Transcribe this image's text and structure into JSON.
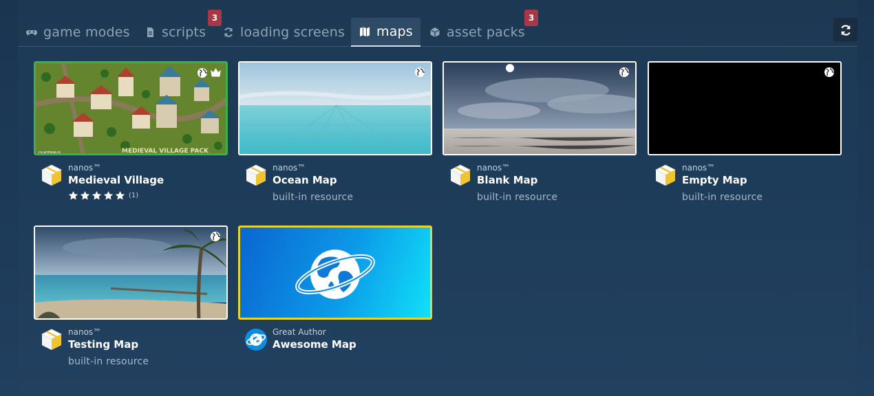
{
  "tabs": [
    {
      "label": "game modes",
      "icon": "gamepad-icon"
    },
    {
      "label": "scripts",
      "icon": "file-icon",
      "badge": "3"
    },
    {
      "label": "loading screens",
      "icon": "refresh-icon"
    },
    {
      "label": "maps",
      "icon": "map-icon",
      "active": true
    },
    {
      "label": "asset packs",
      "icon": "cube-icon",
      "badge": "3"
    }
  ],
  "toolbar": {
    "refresh_icon": "refresh-icon"
  },
  "maps": [
    {
      "author": "nanos™",
      "title": "Medieval Village",
      "rating_count": "(1)",
      "stars": 5,
      "thumb_text": "MEDIEVAL VILLAGE PACK",
      "thumb_credit": "QUATERNIUS"
    },
    {
      "author": "nanos™",
      "title": "Ocean Map",
      "subtitle": "built-in resource"
    },
    {
      "author": "nanos™",
      "title": "Blank Map",
      "subtitle": "built-in resource"
    },
    {
      "author": "nanos™",
      "title": "Empty Map",
      "subtitle": "built-in resource"
    },
    {
      "author": "nanos™",
      "title": "Testing Map",
      "subtitle": "built-in resource"
    },
    {
      "author": "Great Author",
      "title": "Awesome Map"
    }
  ],
  "colors": {
    "accent_green": "#38b34a",
    "accent_yellow": "#e8d52a",
    "badge_red": "#a83848"
  }
}
